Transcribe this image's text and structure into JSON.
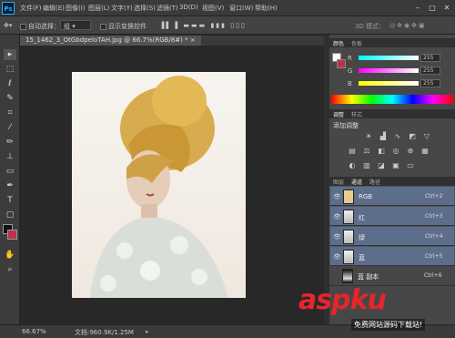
{
  "menubar": {
    "logo": "Ps",
    "items": [
      "文件(F)",
      "编辑(E)",
      "图像(I)",
      "图层(L)",
      "文字(Y)",
      "选择(S)",
      "滤镜(T)",
      "3D(D)",
      "视图(V)",
      "窗口(W)",
      "帮助(H)"
    ],
    "win_min": "–",
    "win_max": "□",
    "win_close": "✕"
  },
  "options": {
    "auto_select_label": "自动选择：",
    "group_value": "组",
    "transform_label": "显示变换控件",
    "mode_3d": "3D 模式："
  },
  "document": {
    "tab_title": "15_1462_3_OtGbdpeloTAH.jpg @ 66.7%(RGB/8#) *",
    "tab_close": "×"
  },
  "status": {
    "zoom": "66.67%",
    "doc_info": "文档:960.9K/1.25M"
  },
  "color_panel": {
    "tabs": [
      "颜色",
      "色板"
    ],
    "sliders": [
      {
        "label": "R",
        "value": "255",
        "color": "#ff4040"
      },
      {
        "label": "G",
        "value": "255",
        "color": "#ff40ff"
      },
      {
        "label": "B",
        "value": "255",
        "color": "#ffd000"
      }
    ]
  },
  "adjust_panel": {
    "tabs": [
      "调整",
      "样式"
    ],
    "title": "添加调整"
  },
  "channels_panel": {
    "tabs": [
      "图层",
      "通道",
      "路径"
    ],
    "rows": [
      {
        "name": "RGB",
        "key": "Ctrl+2"
      },
      {
        "name": "红",
        "key": "Ctrl+3"
      },
      {
        "name": "绿",
        "key": "Ctrl+4"
      },
      {
        "name": "蓝",
        "key": "Ctrl+5"
      },
      {
        "name": "蓝 副本",
        "key": "Ctrl+6"
      }
    ]
  },
  "watermark": {
    "logo": "aspku",
    "sub": "免费网站源码下载站!"
  }
}
